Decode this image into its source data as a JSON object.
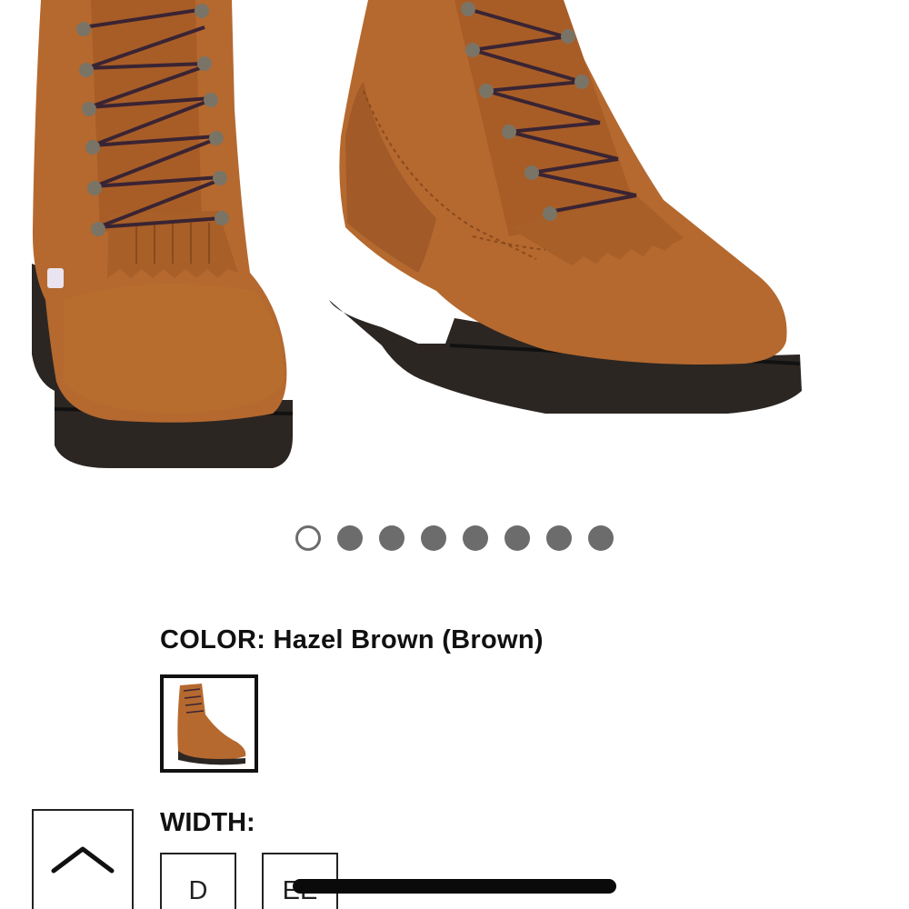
{
  "product": {
    "image_alt": "Hazel Brown lace-up work boots",
    "carousel": {
      "total": 8,
      "active_index": 0
    }
  },
  "color": {
    "label": "COLOR:",
    "value": "Hazel Brown (Brown)"
  },
  "width": {
    "label": "WIDTH:",
    "options": [
      "D",
      "EE"
    ]
  },
  "controls": {
    "back_to_top_icon": "chevron-up-icon"
  },
  "colors": {
    "leather": "#b5692f",
    "leather_dark": "#8f4f22",
    "sole": "#2c2623",
    "dot": "#6c6c6c"
  }
}
